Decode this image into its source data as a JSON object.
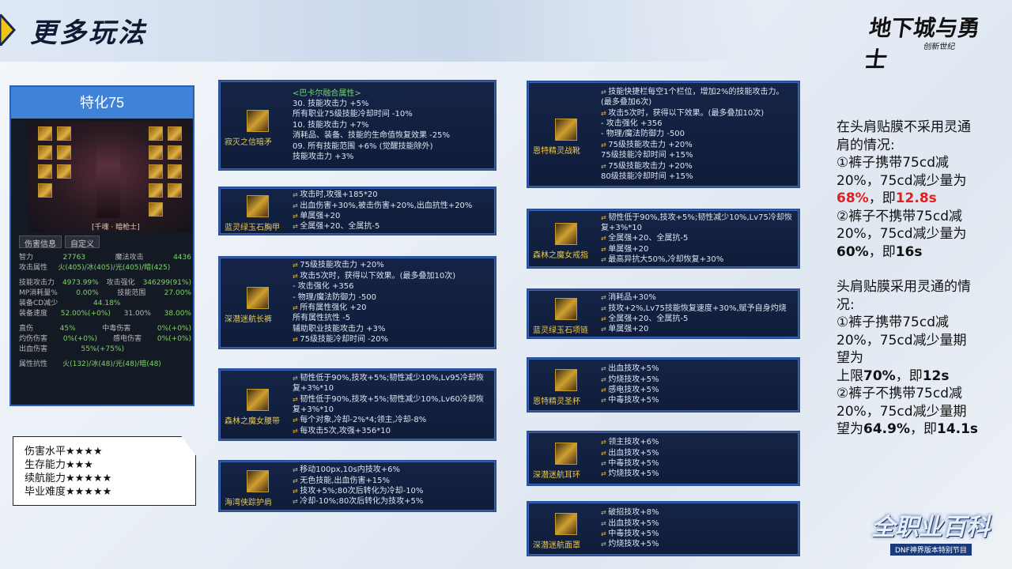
{
  "header": {
    "title": "更多玩法"
  },
  "logo": {
    "main": "地下城与勇士",
    "sub": "创新世纪"
  },
  "char_panel": {
    "title": "特化75",
    "char_name": "[千魂 · 暗枪士]",
    "tabs": [
      "伤害信息",
      "自定义"
    ],
    "stats": [
      {
        "label": "智力",
        "val": "27763",
        "label2": "魔法攻击",
        "val2": "4436"
      },
      {
        "label": "攻击属性",
        "val": "火(405)/冰(405)/光(405)/暗(425)",
        "label2": "",
        "val2": ""
      },
      {
        "sep": true
      },
      {
        "label": "技能攻击力",
        "val": "4973.99%",
        "label2": "攻击强化",
        "val2": "346299(91%)"
      },
      {
        "label": "MP消耗量%",
        "val": "0.00%",
        "label2": "技能范围",
        "val2": "27.00%"
      },
      {
        "label": "装备CD减少",
        "val": "44.18%",
        "label2": "",
        "val2": ""
      },
      {
        "label": "装备速度",
        "val": "52.00%(+0%)",
        "label2": "31.00%",
        "val2": "38.00%"
      },
      {
        "sep": true
      },
      {
        "label": "直伤",
        "val": "45%",
        "label2": "中毒伤害",
        "val2": "0%(+0%)"
      },
      {
        "label": "灼伤伤害",
        "val": "0%(+0%)",
        "label2": "感电伤害",
        "val2": "0%(+0%)"
      },
      {
        "label": "出血伤害",
        "val": "55%(+75%)",
        "label2": "",
        "val2": ""
      },
      {
        "sep": true
      },
      {
        "label": "属性抗性",
        "val": "火(132)/冰(48)/光(48)/暗(48)",
        "label2": "",
        "val2": ""
      }
    ]
  },
  "rating": {
    "lines": [
      "伤害水平★★★★",
      "生存能力★★★",
      "续航能力★★★★★",
      "毕业难度★★★★★"
    ]
  },
  "cards": [
    {
      "name": "寂灭之信暗矛",
      "lines": [
        {
          "t": "<巴卡尔融合属性>",
          "k": "head"
        },
        {
          "t": "30. 技能攻击力 +5%",
          "k": "plain"
        },
        {
          "t": "    所有职业75级技能冷却时间 -10%",
          "k": "plain"
        },
        {
          "t": "10. 技能攻击力 +7%",
          "k": "plain"
        },
        {
          "t": "    消耗品、装备、技能的生命值恢复效果 -25%",
          "k": "plain"
        },
        {
          "t": "09. 所有技能范围 +6% (觉醒技能除外)",
          "k": "plain"
        },
        {
          "t": "    技能攻击力 +3%",
          "k": "plain"
        }
      ]
    },
    {
      "name": "蓝灵绿玉石胸甲",
      "lines": [
        {
          "t": "攻击时,攻强+185*20"
        },
        {
          "t": "出血伤害+30%,被击伤害+20%,出血抗性+20%"
        },
        {
          "t": "单属强+20"
        },
        {
          "t": "全属强+20、全属抗-5"
        }
      ]
    },
    {
      "name": "深潜迷航长裤",
      "lines": [
        {
          "t": "75级技能攻击力 +20%"
        },
        {
          "t": "攻击5次时，获得以下效果。(最多叠加10次)"
        },
        {
          "t": "  - 攻击强化 +356",
          "k": "plain"
        },
        {
          "t": "  - 物理/魔法防御力 -500",
          "k": "plain"
        },
        {
          "t": "所有属性强化 +20"
        },
        {
          "t": "所有属性抗性 -5",
          "k": "plain"
        },
        {
          "t": "辅助职业技能攻击力 +3%",
          "k": "plain"
        },
        {
          "t": "75级技能冷却时间 -20%"
        }
      ]
    },
    {
      "name": "森林之魔女腰带",
      "lines": [
        {
          "t": "韧性低于90%,技攻+5%;韧性减少10%,Lv95冷却恢"
        },
        {
          "t": "复+3%*10",
          "k": "plain"
        },
        {
          "t": "韧性低于90%,技攻+5%;韧性减少10%,Lv60冷却恢"
        },
        {
          "t": "复+3%*10",
          "k": "plain"
        },
        {
          "t": "每个对象,冷却-2%*4;领主,冷却-8%"
        },
        {
          "t": "每攻击5次,攻强+356*10"
        }
      ]
    },
    {
      "name": "海湾侠踪护肩",
      "lines": [
        {
          "t": "移动100px,10s内技攻+6%"
        },
        {
          "t": "无色技能,出血伤害+15%"
        },
        {
          "t": "技攻+5%;80次后转化为冷却-10%"
        },
        {
          "t": "冷却-10%;80次后转化为技攻+5%"
        }
      ]
    },
    {
      "name": "恩特精灵战靴",
      "lines": [
        {
          "t": "技能快捷栏每空1个栏位，增加2%的技能攻击力。"
        },
        {
          "t": "(最多叠加6次)",
          "k": "plain"
        },
        {
          "t": "攻击5次时，获得以下效果。(最多叠加10次)"
        },
        {
          "t": "  - 攻击强化 +356",
          "k": "plain"
        },
        {
          "t": "  - 物理/魔法防御力 -500",
          "k": "plain"
        },
        {
          "t": "75级技能攻击力 +20%"
        },
        {
          "t": "75级技能冷却时间 +15%",
          "k": "plain"
        },
        {
          "t": "75级技能攻击力 +20%"
        },
        {
          "t": "80级技能冷却时间 +15%",
          "k": "plain"
        }
      ]
    },
    {
      "name": "森林之魔女戒指",
      "lines": [
        {
          "t": "韧性低于90%,技攻+5%;韧性减少10%,Lv75冷却恢"
        },
        {
          "t": "复+3%*10",
          "k": "plain"
        },
        {
          "t": "全属强+20、全属抗-5"
        },
        {
          "t": "单属强+20"
        },
        {
          "t": "最高异抗大50%,冷却恢复+30%"
        }
      ]
    },
    {
      "name": "蓝灵绿玉石项链",
      "lines": [
        {
          "t": "消耗品+30%"
        },
        {
          "t": "技攻+2%,Lv75技能恢复速度+30%,赋予自身灼烧"
        },
        {
          "t": "全属强+20、全属抗-5"
        },
        {
          "t": "单属强+20"
        }
      ]
    },
    {
      "name": "恩特精灵圣杯",
      "lines": [
        {
          "t": "出血技攻+5%"
        },
        {
          "t": "灼烧技攻+5%"
        },
        {
          "t": "感电技攻+5%"
        },
        {
          "t": "中毒技攻+5%"
        }
      ]
    },
    {
      "name": "深潜迷航耳环",
      "lines": [
        {
          "t": "领主技攻+6%"
        },
        {
          "t": "出血技攻+5%"
        },
        {
          "t": "中毒技攻+5%"
        },
        {
          "t": "灼烧技攻+5%"
        }
      ]
    },
    {
      "name": "深潜迷航面罩",
      "lines": [
        {
          "t": "破招技攻+8%"
        },
        {
          "t": "出血技攻+5%"
        },
        {
          "t": "中毒技攻+5%"
        },
        {
          "t": "灼烧技攻+5%"
        }
      ]
    }
  ],
  "notes": {
    "p1_a": "在头肩贴膜不采用灵通肩的情况:",
    "p1_b": "①裤子携带75cd减20%，75cd减少量为",
    "p1_red": "68%",
    "p1_c": "，即",
    "p1_red2": "12.8s",
    "p1_d": "②裤子不携带75cd减20%，75cd减少量为",
    "p1_bold": "60%",
    "p1_e": "，即",
    "p1_bold2": "16s",
    "p2_a": "头肩贴膜采用灵通的情况:",
    "p2_b": "①裤子携带75cd减20%，75cd减少量期望为",
    "p2_c": "上限",
    "p2_bold": "70%",
    "p2_d": "，即",
    "p2_bold2": "12s",
    "p2_e": "②裤子不携带75cd减20%，75cd减少量期望为",
    "p2_bold3": "64.9%",
    "p2_f": "，即",
    "p2_bold4": "14.1s"
  },
  "badge": {
    "title": "全职业百科",
    "sub": "DNF神界版本特别节目"
  }
}
